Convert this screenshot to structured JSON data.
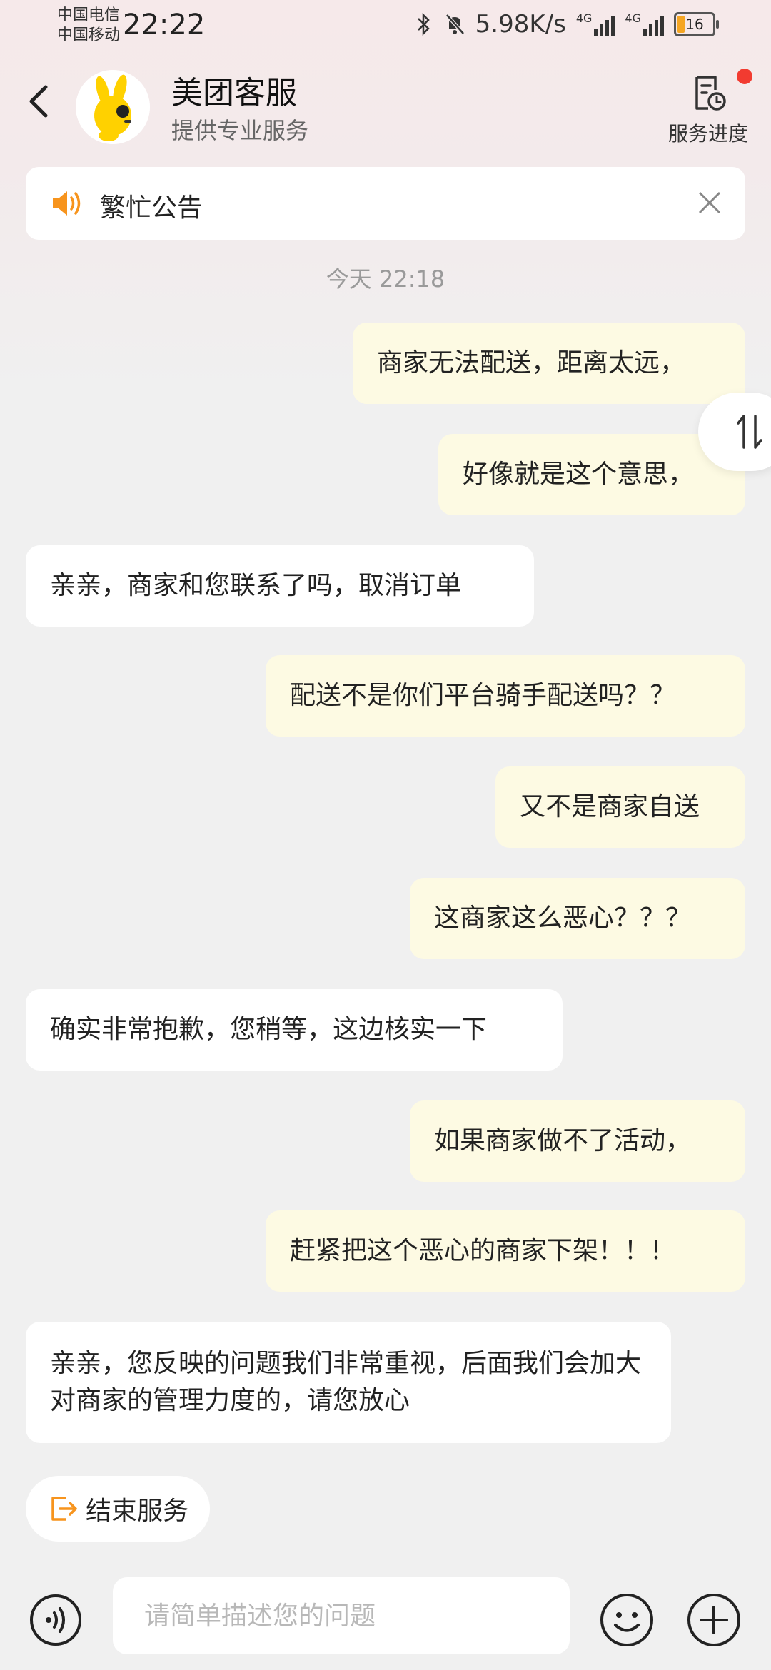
{
  "status_bar": {
    "carrier1": "中国电信",
    "carrier2": "中国移动",
    "time": "22:22",
    "speed": "5.98K/s",
    "net1": "4G",
    "net2": "4G",
    "battery": "16"
  },
  "header": {
    "title": "美团客服",
    "subtitle": "提供专业服务",
    "progress_label": "服务进度"
  },
  "notice": {
    "text": "繁忙公告"
  },
  "chat": {
    "timestamp": "今天 22:18",
    "messages": [
      {
        "from": "me",
        "text": "商家无法配送，距离太远，"
      },
      {
        "from": "me",
        "text": "好像就是这个意思，"
      },
      {
        "from": "agent",
        "text": "亲亲，商家和您联系了吗，取消订单"
      },
      {
        "from": "me",
        "text": "配送不是你们平台骑手配送吗？？"
      },
      {
        "from": "me",
        "text": "又不是商家自送"
      },
      {
        "from": "me",
        "text": "这商家这么恶心？？？"
      },
      {
        "from": "agent",
        "text": "确实非常抱歉，您稍等，这边核实一下"
      },
      {
        "from": "me",
        "text": "如果商家做不了活动，"
      },
      {
        "from": "me",
        "text": "赶紧把这个恶心的商家下架！！！"
      },
      {
        "from": "agent",
        "text": "亲亲，您反映的问题我们非常重视，后面我们会加大对商家的管理力度的，请您放心"
      }
    ]
  },
  "footer": {
    "end_service": "结束服务",
    "input_placeholder": "请简单描述您的问题"
  },
  "colors": {
    "my_bubble": "#fdfae3",
    "agent_bubble": "#ffffff",
    "accent": "#f7941d",
    "notification_dot": "#f23b30"
  }
}
